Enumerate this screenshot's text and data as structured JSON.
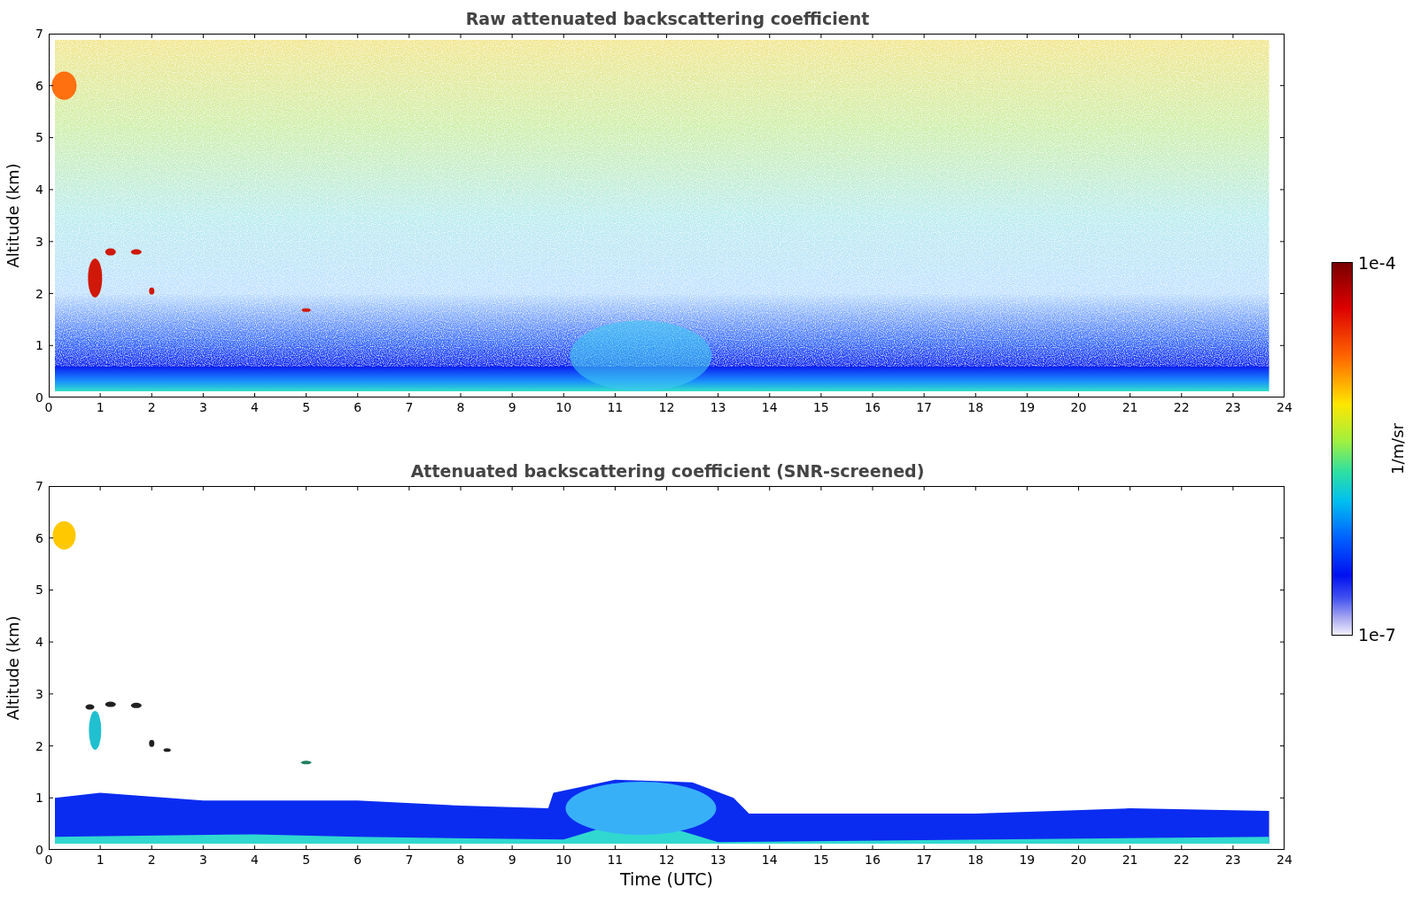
{
  "plots": [
    {
      "kind": "raw",
      "title": "Raw attenuated backscattering coefficient",
      "ylabel": "Altitude (km)",
      "yticks": [
        "7",
        "6",
        "5",
        "4",
        "3",
        "2",
        "1",
        "0"
      ],
      "xticks": [
        "0",
        "1",
        "2",
        "3",
        "4",
        "5",
        "6",
        "7",
        "8",
        "9",
        "10",
        "11",
        "12",
        "13",
        "14",
        "15",
        "16",
        "17",
        "18",
        "19",
        "20",
        "21",
        "22",
        "23",
        "24"
      ]
    },
    {
      "kind": "screened",
      "title": "Attenuated backscattering coefficient (SNR-screened)",
      "ylabel": "Altitude (km)",
      "yticks": [
        "7",
        "6",
        "5",
        "4",
        "3",
        "2",
        "1",
        "0"
      ],
      "xticks": [
        "0",
        "1",
        "2",
        "3",
        "4",
        "5",
        "6",
        "7",
        "8",
        "9",
        "10",
        "11",
        "12",
        "13",
        "14",
        "15",
        "16",
        "17",
        "18",
        "19",
        "20",
        "21",
        "22",
        "23",
        "24"
      ],
      "xlabel": "Time (UTC)"
    }
  ],
  "colorbar": {
    "max_label": "1e-4",
    "min_label": "1e-7",
    "unit": "1/m/sr"
  }
}
